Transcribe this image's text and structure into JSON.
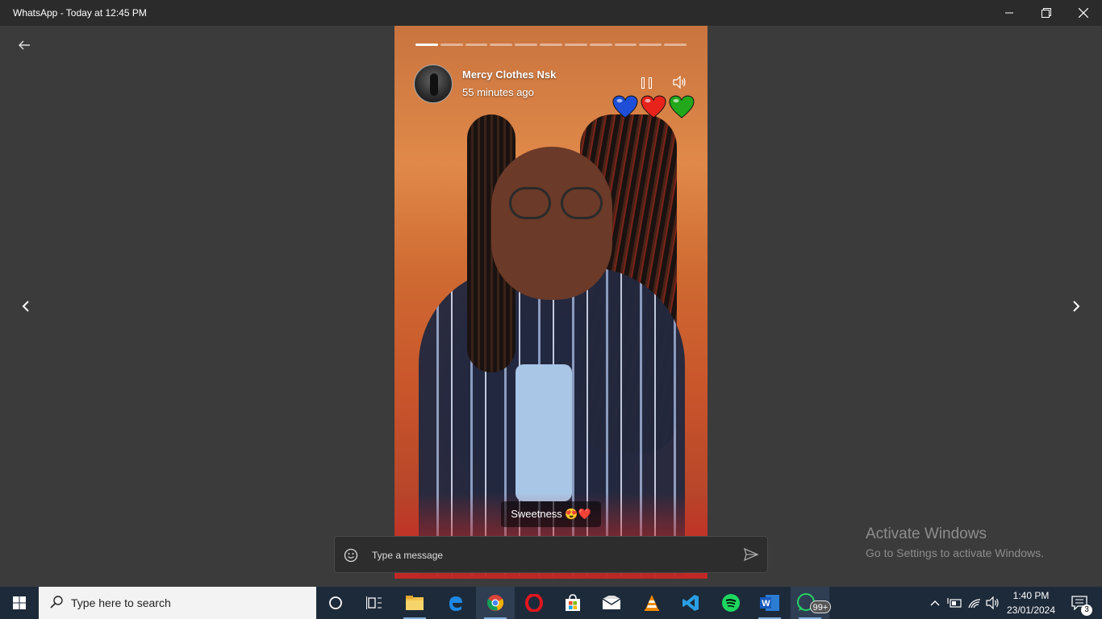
{
  "window": {
    "title": "WhatsApp - Today at 12:45 PM",
    "minimize_icon": "minimize-icon",
    "maximize_icon": "restore-icon",
    "close_icon": "close-icon"
  },
  "status": {
    "sender_name": "Mercy Clothes Nsk",
    "posted_time": "55 minutes ago",
    "progress_segments": 11,
    "active_segment": 1,
    "caption": "Sweetness 😍❤️",
    "hearts": [
      {
        "color": "#1f4fd8",
        "name": "blue-heart"
      },
      {
        "color": "#e8231c",
        "name": "red-heart"
      },
      {
        "color": "#23a81c",
        "name": "green-heart"
      }
    ]
  },
  "reply": {
    "placeholder": "Type a message"
  },
  "watermark": {
    "line1": "Activate Windows",
    "line2": "Go to Settings to activate Windows."
  },
  "taskbar": {
    "search_placeholder": "Type here to search",
    "whatsapp_badge": "99+",
    "clock_time": "1:40 PM",
    "clock_date": "23/01/2024",
    "notification_count": "3"
  },
  "colors": {
    "titlebar": "#2b2b2b",
    "viewer_bg": "#3b3b3b",
    "taskbar": "#1d2a3a"
  }
}
